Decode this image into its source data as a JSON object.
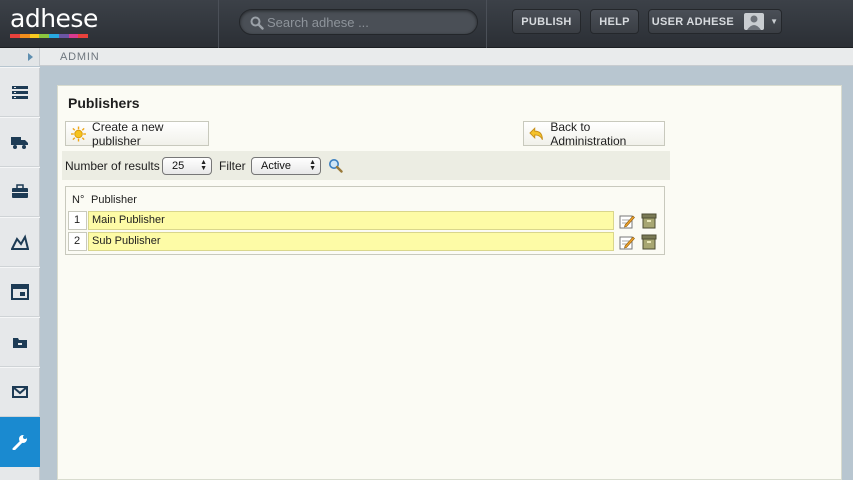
{
  "app": {
    "logo_text": "adhese",
    "logo_colors": [
      "#e8413c",
      "#f28e1c",
      "#f8c91f",
      "#8cc63e",
      "#28a9e0",
      "#6b56a4",
      "#d93a8f",
      "#e8413c"
    ]
  },
  "search": {
    "placeholder": "Search adhese ..."
  },
  "topnav": {
    "publish_label": "PUBLISH",
    "help_label": "HELP",
    "user_label": "USER ADHESE"
  },
  "breadcrumb": {
    "current": "ADMIN"
  },
  "sidebar": {
    "items": [
      {
        "icon": "inventory-icon"
      },
      {
        "icon": "delivery-truck-icon"
      },
      {
        "icon": "briefcase-icon"
      },
      {
        "icon": "campaign-chart-icon"
      },
      {
        "icon": "calendar-icon"
      },
      {
        "icon": "folder-icon"
      },
      {
        "icon": "mail-icon"
      },
      {
        "icon": "wrench-icon",
        "active": true
      }
    ]
  },
  "page": {
    "title": "Publishers",
    "create_label": "Create a new publisher",
    "back_label": "Back to Administration",
    "results_label": "Number of results",
    "results_value": "25",
    "filter_label": "Filter",
    "filter_value": "Active"
  },
  "table": {
    "columns": [
      "N°",
      "Publisher"
    ],
    "rows": [
      {
        "num": "1",
        "name": "Main Publisher"
      },
      {
        "num": "2",
        "name": "Sub Publisher"
      }
    ]
  },
  "colors": {
    "accent": "#1a8ad0",
    "row_highlight": "#fdfba6",
    "panel_bg": "#fbfbf4"
  }
}
